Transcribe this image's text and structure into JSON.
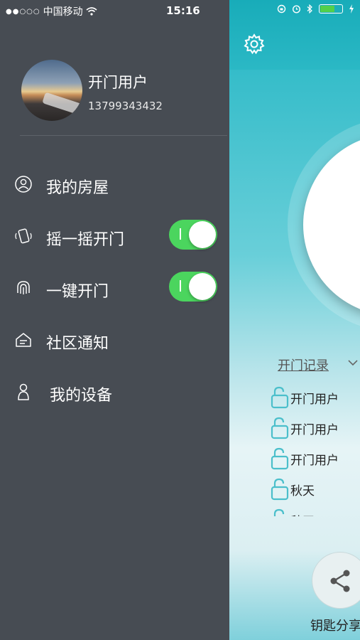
{
  "status_bar": {
    "signal": "●●○○○",
    "carrier": "中国移动",
    "time": "15:16"
  },
  "profile": {
    "name": "开门用户",
    "phone": "13799343432"
  },
  "menu": {
    "items": [
      {
        "label": "我的房屋",
        "icon": "user-circle-icon"
      },
      {
        "label": "摇一摇开门",
        "icon": "shake-phone-icon",
        "toggle_on": true
      },
      {
        "label": "一键开门",
        "icon": "fingerprint-icon",
        "toggle_on": true
      },
      {
        "label": "社区通知",
        "icon": "notice-icon"
      },
      {
        "label": "我的设备",
        "icon": "person-outline-icon"
      }
    ]
  },
  "main": {
    "records_title": "开门记录",
    "records": [
      {
        "name": "开门用户"
      },
      {
        "name": "开门用户"
      },
      {
        "name": "开门用户"
      },
      {
        "name": "秋天"
      },
      {
        "name": "秋天"
      }
    ],
    "share_label": "钥匙分享"
  },
  "colors": {
    "drawer_bg": "#474c53",
    "toggle_on": "#4bd55e",
    "accent_teal": "#1fb2c0",
    "lock_teal": "#4bbfcb"
  }
}
